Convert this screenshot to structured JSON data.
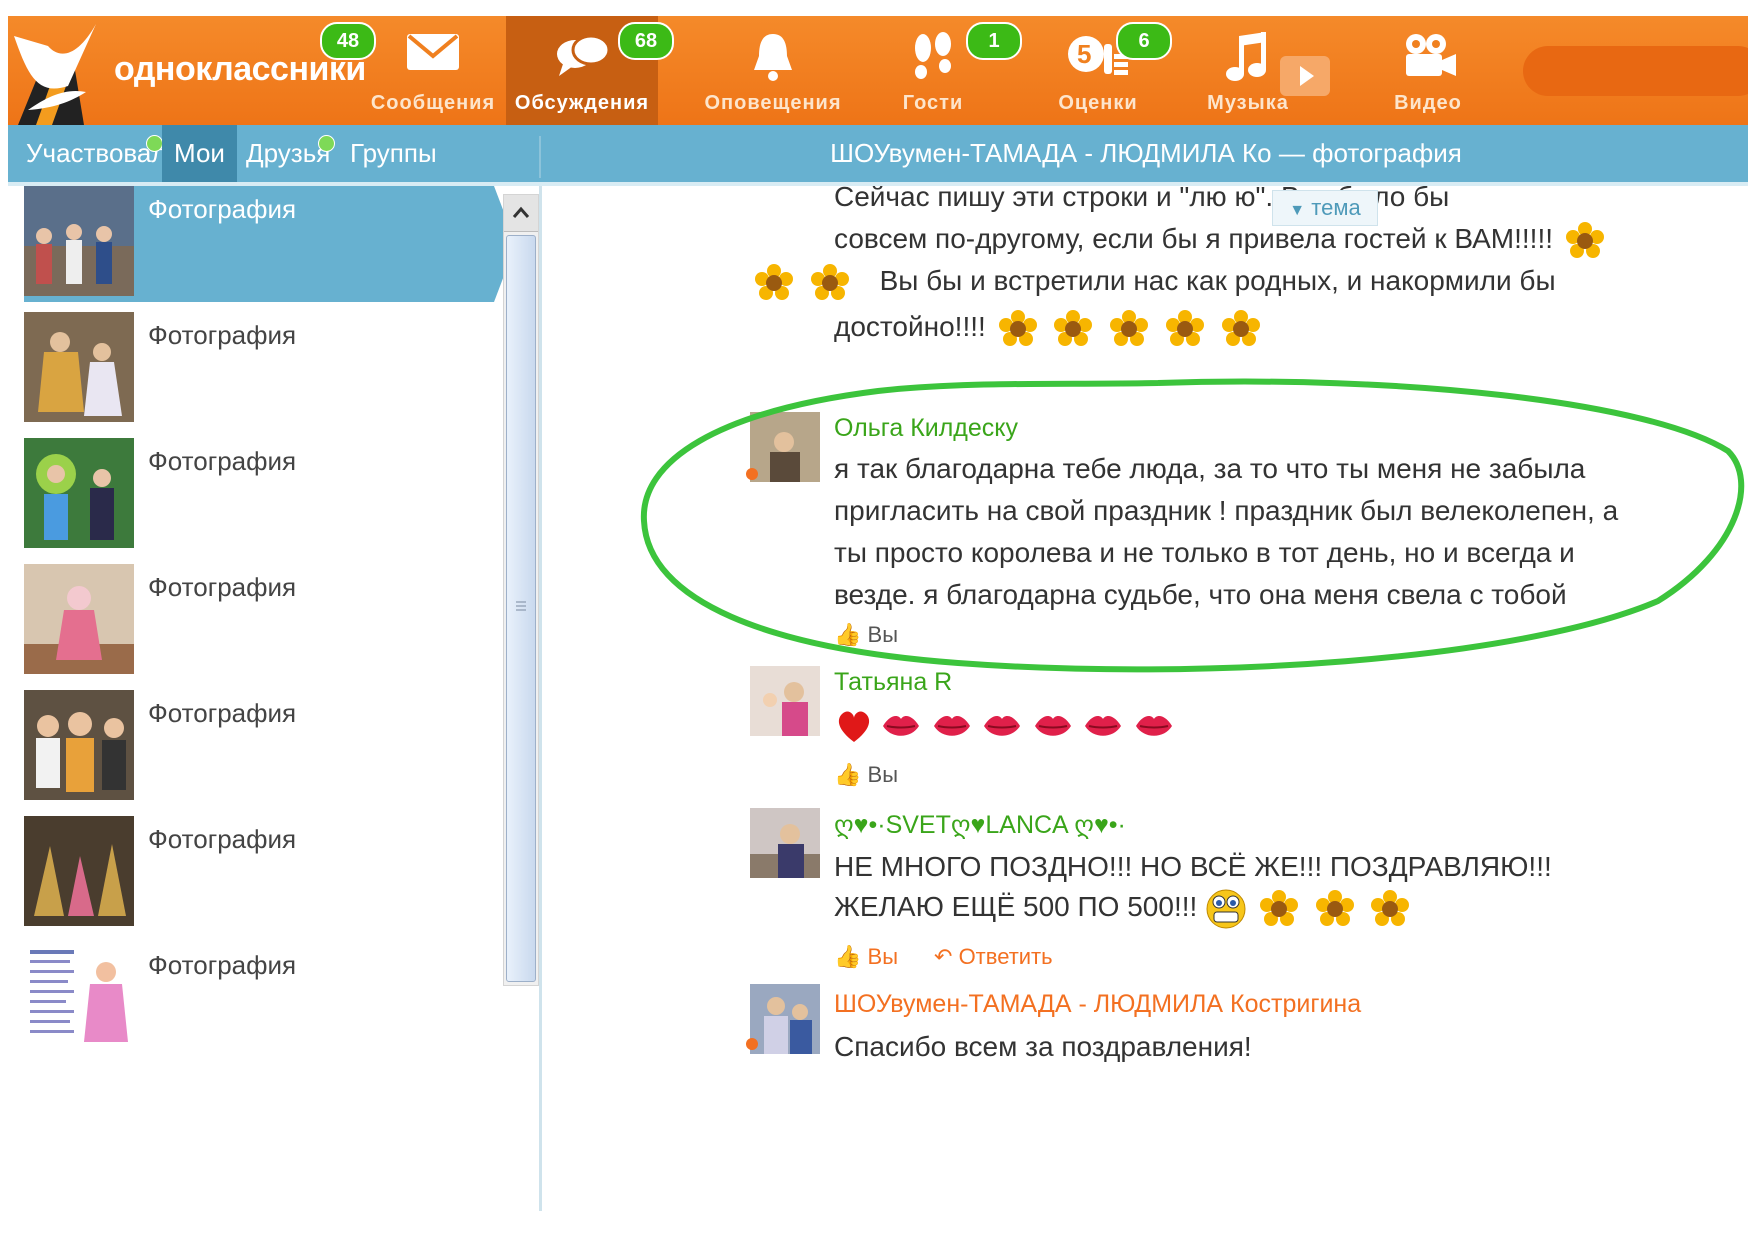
{
  "brand": {
    "name": "одноклассники"
  },
  "nav": [
    {
      "id": "messages",
      "label": "Сообщения",
      "icon": "envelope-icon",
      "badge": "48"
    },
    {
      "id": "discussions",
      "label": "Обсуждения",
      "icon": "chat-bubbles-icon",
      "badge": "68",
      "active": true
    },
    {
      "id": "notifications",
      "label": "Оповещения",
      "icon": "bell-icon",
      "badge": ""
    },
    {
      "id": "guests",
      "label": "Гости",
      "icon": "footprints-icon",
      "badge": "1"
    },
    {
      "id": "ratings",
      "label": "Оценки",
      "icon": "rating-five-icon",
      "badge": "6"
    },
    {
      "id": "music",
      "label": "Музыка",
      "icon": "music-note-icon",
      "badge": ""
    },
    {
      "id": "video",
      "label": "Видео",
      "icon": "film-camera-icon",
      "badge": ""
    }
  ],
  "subtabs": [
    {
      "label": "Участвовал",
      "dot": true
    },
    {
      "label": "Мои",
      "active": true,
      "dot": false
    },
    {
      "label": "Друзья",
      "dot": true
    },
    {
      "label": "Группы",
      "dot": false
    }
  ],
  "thread_title": "ШОУвумен-ТАМАДА - ЛЮДМИЛА Ко⁠ — фотография",
  "photos": [
    {
      "label": "Фотография",
      "selected": true
    },
    {
      "label": "Фотография"
    },
    {
      "label": "Фотография"
    },
    {
      "label": "Фотография"
    },
    {
      "label": "Фотография"
    },
    {
      "label": "Фотография"
    },
    {
      "label": "Фотография"
    }
  ],
  "tema_label": "тема",
  "top_message": {
    "line1": "Сейчас пишу эти строки и \"лю                ю\". Все было бы",
    "line2": "совсем по-другому, если бы я привела гостей к ВАМ!!!!!",
    "line3": "Вы бы и встретили нас как родных, и накормили бы",
    "line4": "достойно!!!!"
  },
  "comments": [
    {
      "author": "Ольга Килдеску",
      "author_color": "#3aa51a",
      "lines": [
        "я так благодарна тебе люда, за то что ты меня не забыла",
        "пригласить на свой праздник ! праздник был велеколепен, а",
        "ты просто королева и не только в тот день, но и всегда и",
        "везде. я благодарна судьбе, что она меня свела с тобой"
      ],
      "like": "Вы"
    },
    {
      "author": "Татьяна R",
      "author_color": "#3aa51a",
      "like": "Вы"
    },
    {
      "author": "ღ♥•·SVETღ♥LANCA ღ♥•·",
      "author_color": "#3aa51a",
      "lines": [
        "НЕ МНОГО ПОЗДНО!!! НО ВСЁ ЖЕ!!! ПОЗДРАВЛЯЮ!!!",
        "ЖЕЛАЮ ЕЩЁ 500 ПО 500!!!"
      ],
      "like": "Вы",
      "reply": "Ответить"
    },
    {
      "author": "ШОУвумен-ТАМАДА - ЛЮДМИЛА Костригина",
      "author_color": "#f37021",
      "lines": [
        "Спасибо всем за поздравления!"
      ]
    }
  ],
  "colors": {
    "orange": "#f37021",
    "blue": "#67b1d0",
    "highlight_oval": "#3cc43c"
  }
}
